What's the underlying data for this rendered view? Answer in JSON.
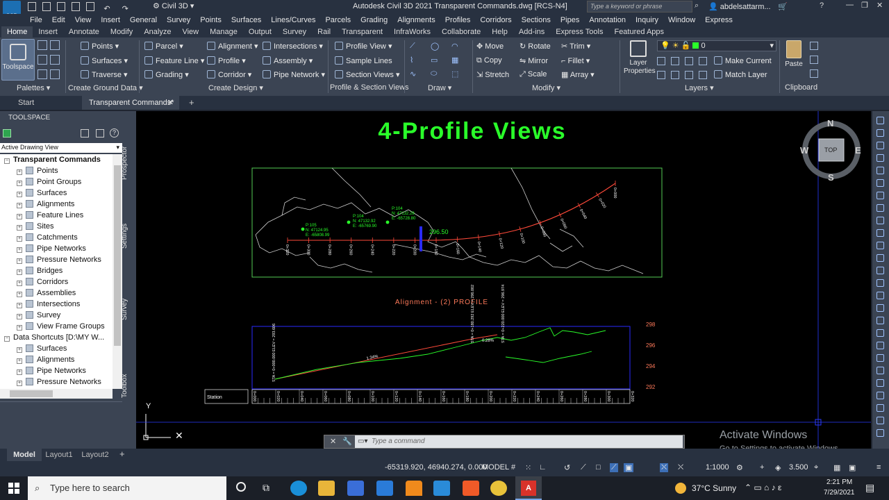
{
  "title_bar": {
    "app_menu": "C3D",
    "workspace": "Civil 3D",
    "title": "Autodesk Civil 3D 2021    Transparent Commands.dwg [RCS-N4]",
    "search_placeholder": "Type a keyword or phrase",
    "user": "abdelsattarm..."
  },
  "menu": [
    "File",
    "Edit",
    "View",
    "Insert",
    "General",
    "Survey",
    "Points",
    "Surfaces",
    "Lines/Curves",
    "Parcels",
    "Grading",
    "Alignments",
    "Profiles",
    "Corridors",
    "Sections",
    "Pipes",
    "Annotation",
    "Inquiry",
    "Window",
    "Express"
  ],
  "ribbon_tabs": [
    "Home",
    "Insert",
    "Annotate",
    "Modify",
    "Analyze",
    "View",
    "Manage",
    "Output",
    "Survey",
    "Rail",
    "Transparent",
    "InfraWorks",
    "Collaborate",
    "Help",
    "Add-ins",
    "Express Tools",
    "Featured Apps"
  ],
  "ribbon": {
    "toolspace": "Toolspace",
    "palettes": "Palettes",
    "create_ground": {
      "label": "Create Ground Data",
      "points": "Points",
      "surfaces": "Surfaces",
      "traverse": "Traverse"
    },
    "create_design": {
      "label": "Create Design",
      "parcel": "Parcel",
      "feature_line": "Feature Line",
      "grading": "Grading",
      "alignment": "Alignment",
      "profile": "Profile",
      "corridor": "Corridor",
      "intersections": "Intersections",
      "assembly": "Assembly",
      "pipe_network": "Pipe Network"
    },
    "profile_section": {
      "label": "Profile & Section Views",
      "profile_view": "Profile View",
      "sample_lines": "Sample Lines",
      "section_views": "Section Views"
    },
    "draw": {
      "label": "Draw"
    },
    "modify": {
      "label": "Modify",
      "move": "Move",
      "rotate": "Rotate",
      "trim": "Trim",
      "copy": "Copy",
      "mirror": "Mirror",
      "fillet": "Fillet",
      "stretch": "Stretch",
      "scale": "Scale",
      "array": "Array"
    },
    "layers": {
      "label": "Layers",
      "layer_properties": "Layer Properties",
      "layer_value": "0",
      "make_current": "Make Current",
      "match_layer": "Match Layer"
    },
    "clipboard": {
      "label": "Clipboard",
      "paste": "Paste"
    }
  },
  "doc_tabs": {
    "start": "Start",
    "active": "Transparent Commands*"
  },
  "toolspace": {
    "header": "TOOLSPACE",
    "view_select": "Active Drawing View",
    "tree": [
      {
        "label": "Transparent Commands",
        "level": 0,
        "bold": true
      },
      {
        "label": "Points",
        "level": 1
      },
      {
        "label": "Point Groups",
        "level": 1
      },
      {
        "label": "Surfaces",
        "level": 1
      },
      {
        "label": "Alignments",
        "level": 1
      },
      {
        "label": "Feature Lines",
        "level": 1
      },
      {
        "label": "Sites",
        "level": 1
      },
      {
        "label": "Catchments",
        "level": 1
      },
      {
        "label": "Pipe Networks",
        "level": 1
      },
      {
        "label": "Pressure Networks",
        "level": 1
      },
      {
        "label": "Bridges",
        "level": 1
      },
      {
        "label": "Corridors",
        "level": 1
      },
      {
        "label": "Assemblies",
        "level": 1
      },
      {
        "label": "Intersections",
        "level": 1
      },
      {
        "label": "Survey",
        "level": 1
      },
      {
        "label": "View Frame Groups",
        "level": 1
      },
      {
        "label": "Data Shortcuts [D:\\MY W...",
        "level": 0
      },
      {
        "label": "Surfaces",
        "level": 1
      },
      {
        "label": "Alignments",
        "level": 1
      },
      {
        "label": "Pipe Networks",
        "level": 1
      },
      {
        "label": "Pressure Networks",
        "level": 1
      }
    ],
    "side_tabs": [
      "Prospector",
      "Settings",
      "Survey",
      "Toolbox"
    ]
  },
  "drawing": {
    "heading": "4-Profile Views",
    "profile_title": "Alignment - (2) PROFILE",
    "station_label": "Station",
    "point_labels": [
      {
        "id": "P:104",
        "n": "N: 47132.28",
        "e": "E: -65728.80"
      },
      {
        "id": "P:104",
        "n": "N: 47132.92",
        "e": "E: -65769.90"
      },
      {
        "id": "P:105",
        "n": "N: 47124.95",
        "e": "E: -65808.99"
      }
    ],
    "offset_label": "296.50",
    "elev_ticks": [
      "298",
      "296",
      "294",
      "292"
    ],
    "grade_1": "1.34%",
    "grade_2": "0.28%",
    "pvi_1": "STA = 0+000.000  ELEV = 293.606",
    "pvi_2": "STA = 0+180.292  ELEV = 296.002",
    "pvi_3": "STA = 0+220.000  ELEV = 296.974",
    "plan_stations": [
      "0+320",
      "0+300",
      "0+280",
      "0+260",
      "0+240",
      "0+220",
      "0+200",
      "0+180",
      "0+160",
      "0+140",
      "0+120",
      "0+100",
      "0+080",
      "0+060",
      "0+040",
      "0+020",
      "0+000"
    ],
    "profile_stations": [
      "0+000",
      "0+020",
      "0+040",
      "0+060",
      "0+080",
      "0+100",
      "0+120",
      "0+140",
      "0+160",
      "0+180",
      "0+200",
      "0+220",
      "0+240",
      "0+260",
      "0+280",
      "0+300",
      "0+320"
    ]
  },
  "viewcube": {
    "n": "N",
    "s": "S",
    "e": "E",
    "w": "W",
    "top": "TOP"
  },
  "command": {
    "placeholder": "Type a command"
  },
  "watermark": {
    "line1": "Activate Windows",
    "line2": "Go to Settings to activate Windows."
  },
  "layout_tabs": [
    "Model",
    "Layout1",
    "Layout2"
  ],
  "status": {
    "coords": "-65319.920, 46940.274, 0.000",
    "model": "MODEL",
    "scale": "1:1000",
    "value": "3.500"
  },
  "taskbar": {
    "search_placeholder": "Type here to search",
    "weather": "37°C  Sunny",
    "time": "2:21 PM",
    "date": "7/29/2021"
  },
  "colors": {
    "accent_green": "#2aff2a",
    "profile_red": "#ff4a3a",
    "axis_blue": "#2a2aff"
  }
}
